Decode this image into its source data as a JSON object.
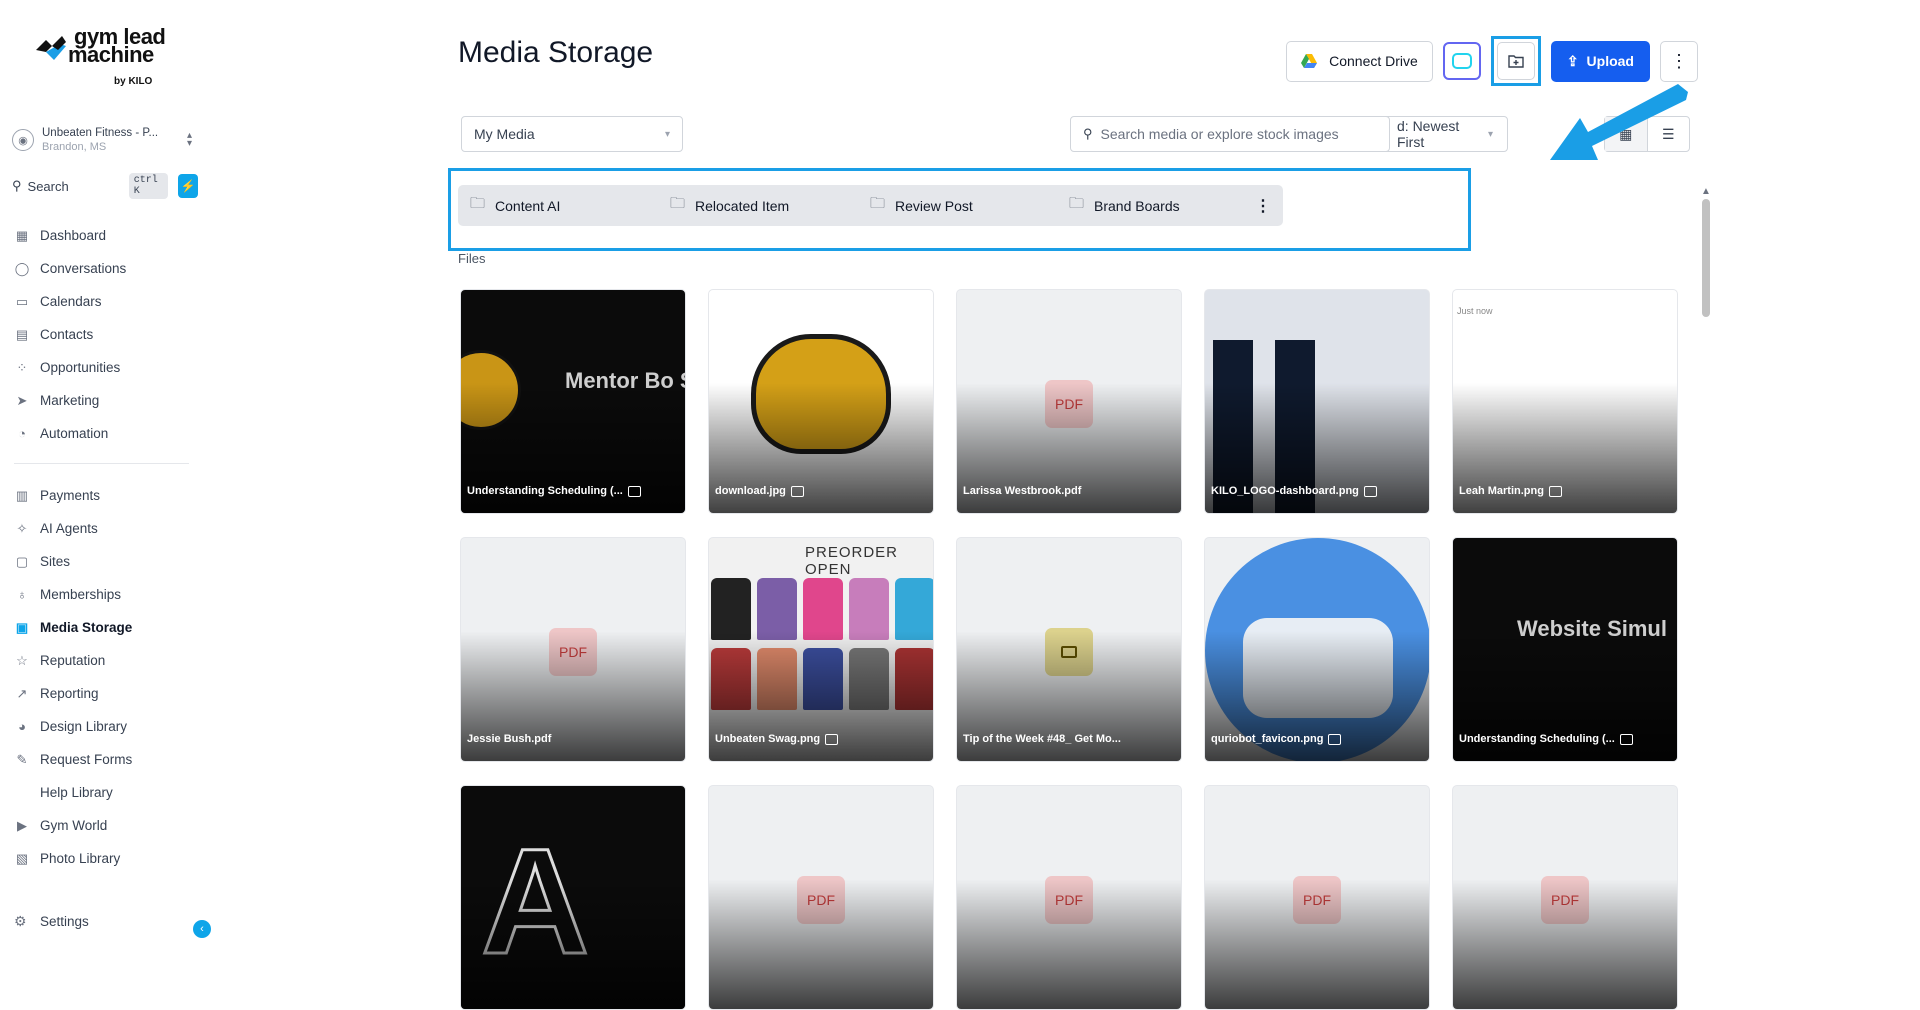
{
  "brand": {
    "line1": "gym lead",
    "line2": "machine",
    "by": "by KILO"
  },
  "account": {
    "name": "Unbeaten Fitness - P...",
    "location": "Brandon, MS"
  },
  "sidebar_search": {
    "label": "Search",
    "shortcut": "ctrl K"
  },
  "nav": [
    {
      "label": "Dashboard",
      "icon": "grid-icon"
    },
    {
      "label": "Conversations",
      "icon": "chat-icon"
    },
    {
      "label": "Calendars",
      "icon": "calendar-icon"
    },
    {
      "label": "Contacts",
      "icon": "contacts-icon"
    },
    {
      "label": "Opportunities",
      "icon": "opportunities-icon"
    },
    {
      "label": "Marketing",
      "icon": "send-icon"
    },
    {
      "label": "Automation",
      "icon": "automation-icon"
    }
  ],
  "nav2": [
    {
      "label": "Payments",
      "icon": "payments-icon"
    },
    {
      "label": "AI Agents",
      "icon": "sparkle-icon"
    },
    {
      "label": "Sites",
      "icon": "sites-icon"
    },
    {
      "label": "Memberships",
      "icon": "award-icon"
    },
    {
      "label": "Media Storage",
      "icon": "image-icon",
      "active": true
    },
    {
      "label": "Reputation",
      "icon": "star-icon"
    },
    {
      "label": "Reporting",
      "icon": "trend-icon"
    },
    {
      "label": "Design Library",
      "icon": "palette-icon"
    },
    {
      "label": "Request Forms",
      "icon": "wrench-icon"
    },
    {
      "label": "Help Library",
      "icon": ""
    },
    {
      "label": "Gym World",
      "icon": "youtube-icon"
    },
    {
      "label": "Photo Library",
      "icon": "photos-icon"
    }
  ],
  "settings_label": "Settings",
  "page": {
    "title": "Media Storage"
  },
  "toolbar": {
    "connect_drive": "Connect Drive",
    "upload": "Upload",
    "folder_filter": "My Media",
    "search_placeholder": "Search media or explore stock images",
    "sort": "d: Newest First"
  },
  "folders": [
    "Content AI",
    "Relocated Item",
    "Review Post",
    "Brand Boards"
  ],
  "files_label": "Files",
  "files": [
    {
      "name": "Understanding Scheduling (...",
      "kind": "image",
      "overlay": "Mentor Bo Simulation"
    },
    {
      "name": "download.jpg",
      "kind": "image"
    },
    {
      "name": "Larissa Westbrook.pdf",
      "kind": "pdf"
    },
    {
      "name": "KILO_LOGO-dashboard.png",
      "kind": "image"
    },
    {
      "name": "Leah Martin.png",
      "kind": "image",
      "overlay": "Just now"
    },
    {
      "name": "Jessie Bush.pdf",
      "kind": "pdf"
    },
    {
      "name": "Unbeaten Swag.png",
      "kind": "image",
      "overlay": "PREORDER OPEN"
    },
    {
      "name": "Tip of the Week #48_ Get Mo...",
      "kind": "video"
    },
    {
      "name": "quriobot_favicon.png",
      "kind": "image"
    },
    {
      "name": "Understanding Scheduling (...",
      "kind": "image",
      "overlay": "Website Simul"
    },
    {
      "name": "",
      "kind": "image"
    },
    {
      "name": "",
      "kind": "pdf"
    },
    {
      "name": "",
      "kind": "pdf"
    },
    {
      "name": "",
      "kind": "pdf"
    },
    {
      "name": "",
      "kind": "pdf"
    }
  ],
  "pdf_badge": "PDF",
  "colors": {
    "accent": "#155eef",
    "highlight": "#1a9ee6",
    "brand_blue": "#0ea5e9"
  }
}
